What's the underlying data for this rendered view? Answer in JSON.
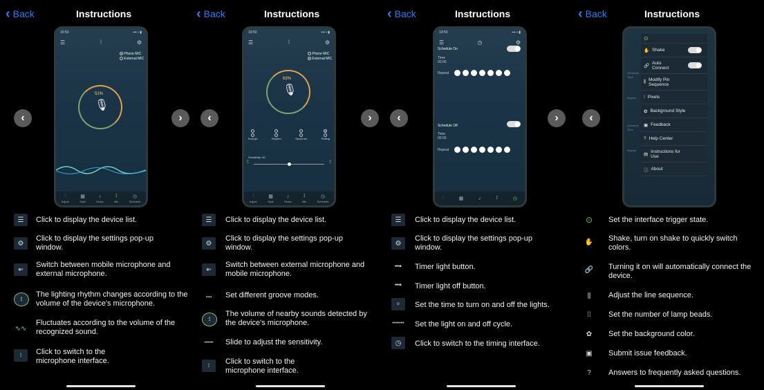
{
  "header": {
    "back_label": "Back",
    "title": "Instructions"
  },
  "phone1": {
    "status_time": "19:50",
    "mic_options": [
      "Phone MIC",
      "External MIC"
    ],
    "percent": "51%",
    "tabs": [
      "Adjust",
      "Style",
      "Music",
      "Mic",
      "Schedule"
    ]
  },
  "phone2": {
    "status_time": "19:50",
    "mic_options": [
      "Phone MIC",
      "External MIC"
    ],
    "percent": "63%",
    "modes": [
      "Energic",
      "Rhythm",
      "Spectrum",
      "Rolling"
    ],
    "sensitivity_label": "Sensitivity: 50",
    "tabs": [
      "Adjust",
      "Style",
      "Music",
      "Mic",
      "Schedule"
    ]
  },
  "phone3": {
    "status_time": "19:50",
    "schedule_on": "Schedule On",
    "schedule_off": "Schedule Off",
    "time_label": "Time",
    "time_value": "00:00",
    "repeat_label": "Repeat"
  },
  "phone4": {
    "menu": [
      "Shake",
      "Auto Connect",
      "Modify Pin Sequence",
      "Pixels",
      "Background Style",
      "Feedback",
      "Help Center",
      "Instructions for Use",
      "About"
    ],
    "bg_labels": [
      "Schedule",
      "Time",
      "Repeat",
      "Schedule",
      "Time",
      "Repeat"
    ]
  },
  "panel1_rows": [
    {
      "icon": "list-icon",
      "text": "Click to display the device list."
    },
    {
      "icon": "settings-icon",
      "text": "Click to display the settings pop-up window."
    },
    {
      "icon": "mic-select-icon",
      "text": "Switch between mobile microphone and external microphone."
    },
    {
      "icon": "mic-ring-icon",
      "text": "The lighting rhythm changes according to the volume of the device's microphone."
    },
    {
      "icon": "wave-icon",
      "text": "Fluctuates according to the volume of the recognized sound."
    },
    {
      "icon": "mic-tab-icon",
      "text": "Click to switch to the microphone interface."
    }
  ],
  "panel2_rows": [
    {
      "icon": "list-icon",
      "text": "Click to display the device list."
    },
    {
      "icon": "settings-icon",
      "text": "Click to display the settings pop-up window."
    },
    {
      "icon": "mic-select-icon",
      "text": "Switch between external microphone and mobile microphone."
    },
    {
      "icon": "groove-icon",
      "text": "Set different groove modes."
    },
    {
      "icon": "mic-ring-icon",
      "text": "The volume of nearby sounds detected by the device's microphone."
    },
    {
      "icon": "slider-icon",
      "text": "Slide to adjust the sensitivity."
    },
    {
      "icon": "mic-tab-icon",
      "text": "Click to switch to the microphone interface."
    }
  ],
  "panel3_rows": [
    {
      "icon": "list-icon",
      "text": "Click to display the device list."
    },
    {
      "icon": "settings-icon",
      "text": "Click to display the settings pop-up window."
    },
    {
      "icon": "timer-on-icon",
      "text": "Timer light button."
    },
    {
      "icon": "timer-off-icon",
      "text": "Timer light off button."
    },
    {
      "icon": "time-icon",
      "text": "Set the time to turn on and off the lights."
    },
    {
      "icon": "cycle-icon",
      "text": "Set the light on and off cycle."
    },
    {
      "icon": "schedule-tab-icon",
      "text": "Click to switch to the timing interface."
    }
  ],
  "panel4_rows": [
    {
      "icon": "trigger-icon",
      "text": "Set the interface trigger state."
    },
    {
      "icon": "shake-icon",
      "text": "Shake, turn on shake to quickly switch colors."
    },
    {
      "icon": "auto-connect-icon",
      "text": "Turning it on will automatically connect the device."
    },
    {
      "icon": "pin-sequence-icon",
      "text": "Adjust the line sequence."
    },
    {
      "icon": "pixels-icon",
      "text": "Set the number of lamp beads."
    },
    {
      "icon": "background-icon",
      "text": "Set the background color."
    },
    {
      "icon": "feedback-icon",
      "text": "Submit issue feedback."
    },
    {
      "icon": "help-icon",
      "text": "Answers to frequently asked questions."
    }
  ],
  "icons": {
    "list": "☰",
    "settings": "⚙",
    "mic": "🎤",
    "back_chev": "‹",
    "prev": "‹",
    "next": "›"
  },
  "colors": {
    "accent_blue": "#2f7cf6",
    "mic_green": "#7ec96a",
    "ring_orange": "#e2a14d"
  }
}
